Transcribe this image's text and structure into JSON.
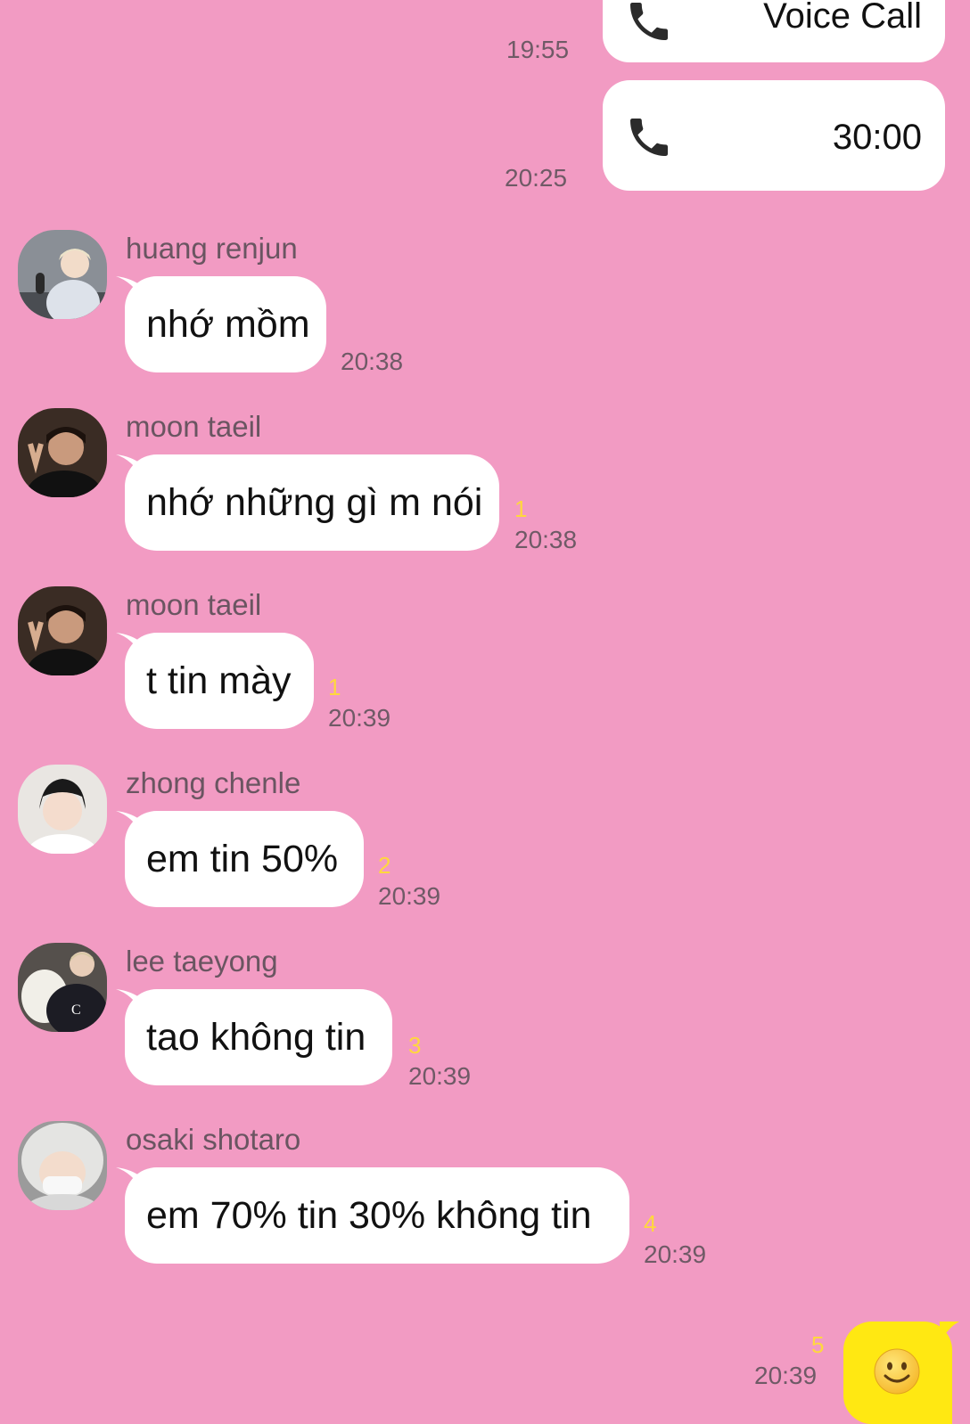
{
  "colors": {
    "background": "#F29BC3",
    "bubble_incoming": "#FFFFFF",
    "bubble_outgoing": "#FFE812",
    "unread": "#FFD83D"
  },
  "calls": [
    {
      "icon": "phone-icon",
      "label": "Voice Call",
      "time": "19:55"
    },
    {
      "icon": "phone-icon",
      "label": "30:00",
      "time": "20:25"
    }
  ],
  "messages": [
    {
      "sender": "huang renjun",
      "text": "nhớ mồm",
      "time": "20:38",
      "unread": ""
    },
    {
      "sender": "moon taeil",
      "text": "nhớ những gì m nói",
      "time": "20:38",
      "unread": "1"
    },
    {
      "sender": "moon taeil",
      "text": "t tin mày",
      "time": "20:39",
      "unread": "1"
    },
    {
      "sender": "zhong chenle",
      "text": "em tin 50%",
      "time": "20:39",
      "unread": "2"
    },
    {
      "sender": "lee taeyong",
      "text": "tao không tin",
      "time": "20:39",
      "unread": "3"
    },
    {
      "sender": "osaki shotaro",
      "text": "em 70% tin 30% không tin",
      "time": "20:39",
      "unread": "4"
    }
  ],
  "my_message": {
    "content": "smiley-emoji-icon",
    "time": "20:39",
    "unread": "5"
  }
}
